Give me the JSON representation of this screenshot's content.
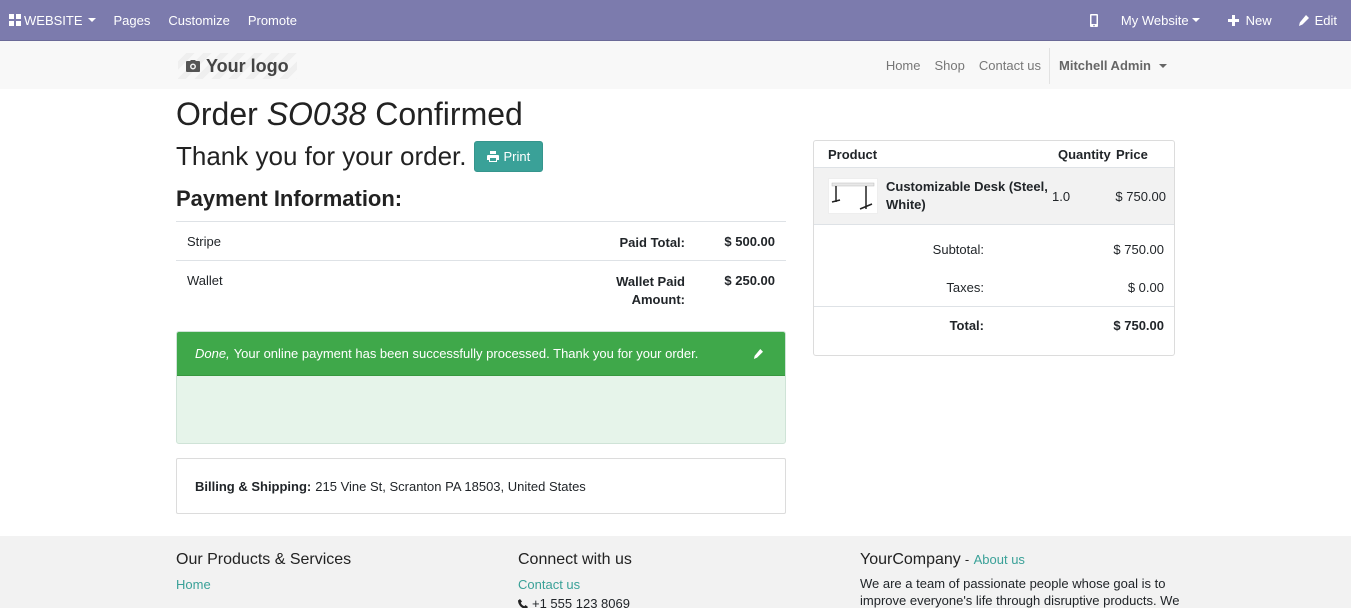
{
  "admin_bar": {
    "website_label": "WEBSITE",
    "pages_label": "Pages",
    "customize_label": "Customize",
    "promote_label": "Promote",
    "my_website_label": "My Website",
    "new_label": "New",
    "edit_label": "Edit"
  },
  "header": {
    "logo_text": "Your logo",
    "nav": [
      "Home",
      "Shop",
      "Contact us"
    ],
    "user": "Mitchell Admin"
  },
  "order": {
    "title_prefix": "Order",
    "order_ref": "SO038",
    "title_suffix": "Confirmed",
    "thanks": "Thank you for your order.",
    "print_label": "Print"
  },
  "payment": {
    "heading": "Payment Information:",
    "rows": [
      {
        "method": "Stripe",
        "label": "Paid Total:",
        "amount": "$ 500.00"
      },
      {
        "method": "Wallet",
        "label": "Wallet Paid Amount:",
        "amount": "$ 250.00"
      }
    ],
    "alert_emph": "Done,",
    "alert_text": "Your online payment has been successfully processed. Thank you for your order."
  },
  "billing": {
    "label": "Billing & Shipping:",
    "address": "215 Vine St, Scranton PA 18503, United States"
  },
  "cart": {
    "headers": {
      "product": "Product",
      "quantity": "Quantity",
      "price": "Price"
    },
    "line": {
      "name": "Customizable Desk (Steel, White)",
      "qty": "1.0",
      "price": "$ 750.00"
    },
    "subtotal_label": "Subtotal:",
    "subtotal": "$ 750.00",
    "taxes_label": "Taxes:",
    "taxes": "$ 0.00",
    "total_label": "Total:",
    "total": "$ 750.00"
  },
  "footer": {
    "col1_title": "Our Products & Services",
    "col1_link": "Home",
    "col2_title": "Connect with us",
    "col2_link": "Contact us",
    "col2_phone": "+1 555 123 8069",
    "col3_title": "YourCompany",
    "col3_sep": "-",
    "col3_link": "About us",
    "col3_text": "We are a team of passionate people whose goal is to improve everyone's life through disruptive products. We"
  },
  "colors": {
    "admin_bar": "#7c7bad",
    "accent": "#3aa198",
    "success": "#3fa84a"
  }
}
